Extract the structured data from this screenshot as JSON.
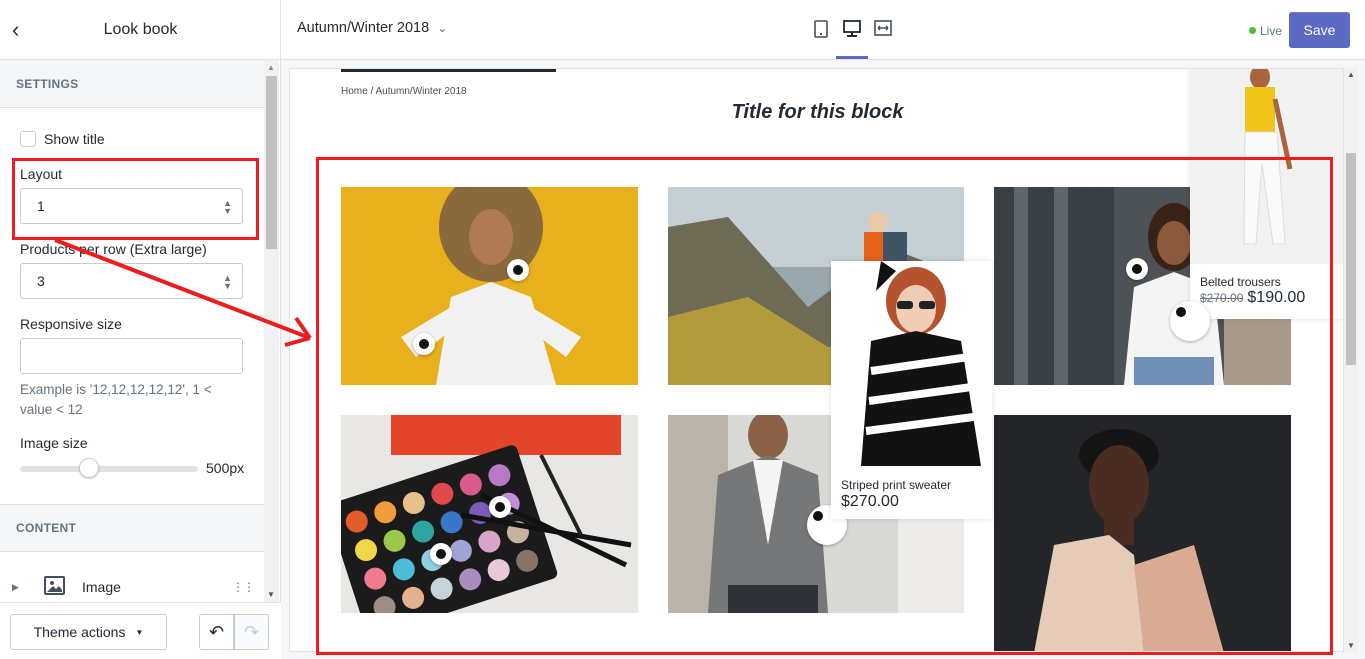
{
  "sidebar": {
    "title": "Look book",
    "settings_heading": "SETTINGS",
    "show_title_label": "Show title",
    "layout_label": "Layout",
    "layout_value": "1",
    "products_per_row_label": "Products per row (Extra large)",
    "products_per_row_value": "3",
    "responsive_size_label": "Responsive size",
    "responsive_size_value": "",
    "responsive_help": "Example is '12,12,12,12,12', 1 < value < 12",
    "image_size_label": "Image size",
    "image_size_value": "500px",
    "image_size_level": 0.35,
    "content_heading": "CONTENT",
    "content_block_label": "Image",
    "theme_actions_label": "Theme actions"
  },
  "topbar": {
    "collection_title": "Autumn/Winter 2018",
    "live_label": "Live",
    "save_label": "Save"
  },
  "preview": {
    "breadcrumb": "Home  /  Autumn/Winter 2018",
    "block_title": "Title for this block",
    "product_cards": [
      {
        "name": "Striped print sweater",
        "price": "$270.00"
      },
      {
        "name": "Belted trousers",
        "old_price": "$270.00",
        "price": "$190.00"
      }
    ]
  },
  "colors": {
    "accent": "#5c6ac4",
    "annotation": "#ee1c1c",
    "live": "#50b83c"
  }
}
